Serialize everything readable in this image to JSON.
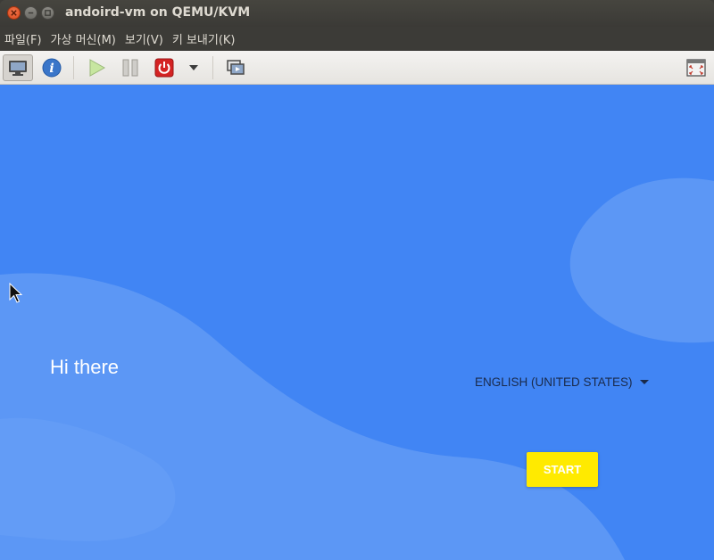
{
  "window": {
    "title": "andoird-vm on QEMU/KVM"
  },
  "menu": {
    "items": [
      "파일(F)",
      "가상 머신(M)",
      "보기(V)",
      "키 보내기(K)"
    ]
  },
  "toolbar": {
    "buttons": [
      "monitor-icon",
      "info-icon",
      "play-icon",
      "pause-icon",
      "power-icon",
      "dropdown-arrow-icon",
      "snapshot-icon",
      "fullscreen-icon"
    ]
  },
  "screen": {
    "greeting": "Hi there",
    "language": "ENGLISH (UNITED STATES)",
    "start_label": "START",
    "colors": {
      "background": "#4185f4",
      "wave": "#5c97f5",
      "start_button": "#ffea00"
    }
  }
}
